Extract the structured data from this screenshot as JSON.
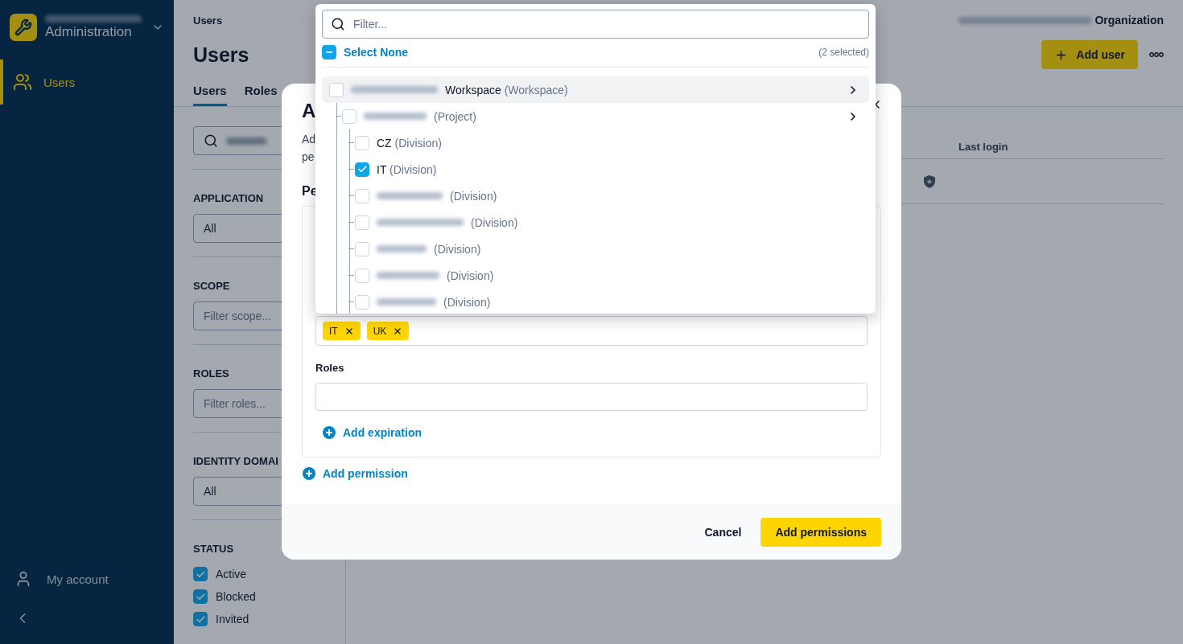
{
  "sidebar": {
    "title": "Administration",
    "items": [
      {
        "label": "Users",
        "selected": true
      }
    ],
    "account": "My account"
  },
  "breadcrumb": "Users",
  "page_title": "Users",
  "tabs": [
    {
      "label": "Users",
      "selected": true
    },
    {
      "label": "Roles",
      "selected": false
    }
  ],
  "header_right": {
    "organization": "Organization",
    "add_button": "Add user"
  },
  "filters": {
    "application": {
      "label": "APPLICATION",
      "value": "All"
    },
    "scope": {
      "label": "SCOPE",
      "placeholder": "Filter scope..."
    },
    "roles": {
      "label": "ROLES",
      "placeholder": "Filter roles..."
    },
    "identity_domain": {
      "label": "IDENTITY DOMAI",
      "value": "All"
    },
    "status": {
      "label": "STATUS",
      "options": [
        {
          "label": "Active",
          "checked": true
        },
        {
          "label": "Blocked",
          "checked": true
        },
        {
          "label": "Invited",
          "checked": true
        }
      ]
    }
  },
  "table": {
    "columns": [
      "Last login"
    ]
  },
  "modal": {
    "title": "A",
    "description_lines": [
      "Ad",
      "pe"
    ],
    "section_title": "Pe",
    "scope_tags": [
      "IT",
      "UK"
    ],
    "roles_label": "Roles",
    "add_expiration": "Add expiration",
    "add_permission": "Add permission",
    "cancel": "Cancel",
    "submit": "Add permissions"
  },
  "dropdown": {
    "filter_placeholder": "Filter...",
    "select_none": "Select None",
    "selected_count": "(2 selected)",
    "tree": [
      {
        "name": "Workspace",
        "type": "(Workspace)",
        "redacted": true,
        "checked": false,
        "highlighted": true,
        "expandable": true,
        "children": [
          {
            "type": "(Project)",
            "redacted": true,
            "checked": false,
            "highlighted": false,
            "expandable": true,
            "children": [
              {
                "name": "CZ",
                "type": "(Division)",
                "redacted": false,
                "checked": false,
                "highlighted": false,
                "expandable": false
              },
              {
                "name": "IT",
                "type": "(Division)",
                "redacted": false,
                "checked": true,
                "highlighted": false,
                "expandable": false
              },
              {
                "type": "(Division)",
                "redacted": true,
                "checked": false,
                "highlighted": false,
                "expandable": false
              },
              {
                "type": "(Division)",
                "redacted": true,
                "checked": false,
                "highlighted": false,
                "expandable": false
              },
              {
                "type": "(Division)",
                "redacted": true,
                "checked": false,
                "highlighted": false,
                "expandable": false
              },
              {
                "type": "(Division)",
                "redacted": true,
                "checked": false,
                "highlighted": false,
                "expandable": false
              },
              {
                "type": "(Division)",
                "redacted": true,
                "checked": false,
                "highlighted": false,
                "expandable": false
              }
            ]
          }
        ]
      }
    ]
  }
}
